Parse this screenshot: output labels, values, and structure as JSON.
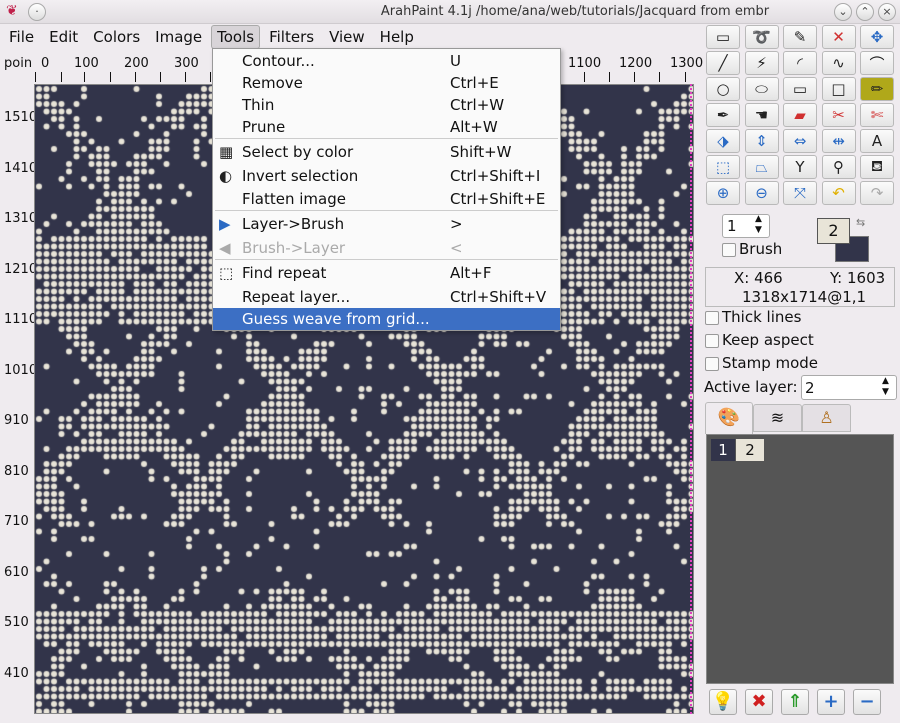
{
  "window": {
    "title": "ArahPaint 4.1j /home/ana/web/tutorials/Jacquard from embr"
  },
  "menubar": [
    "File",
    "Edit",
    "Colors",
    "Image",
    "Tools",
    "Filters",
    "View",
    "Help"
  ],
  "ruler": {
    "unit": "poin",
    "top": [
      "0",
      "100",
      "200",
      "300",
      "1100",
      "1200",
      "1300"
    ],
    "left": [
      "1510",
      "1410",
      "1310",
      "1210",
      "1110",
      "1010",
      "910",
      "810",
      "710",
      "610",
      "510",
      "410"
    ]
  },
  "tools_menu": [
    {
      "label": "Contour...",
      "shortcut": "U"
    },
    {
      "label": "Remove",
      "shortcut": "Ctrl+E"
    },
    {
      "label": "Thin",
      "shortcut": "Ctrl+W"
    },
    {
      "label": "Prune",
      "shortcut": "Alt+W"
    },
    {
      "label": "Select by color",
      "shortcut": "Shift+W",
      "icon": "select-by-color-icon"
    },
    {
      "label": "Invert selection",
      "shortcut": "Ctrl+Shift+I",
      "icon": "invert-selection-icon"
    },
    {
      "label": "Flatten image",
      "shortcut": "Ctrl+Shift+E"
    },
    {
      "label": "Layer->Brush",
      "shortcut": ">",
      "icon": "arrow-right-icon"
    },
    {
      "label": "Brush->Layer",
      "shortcut": "<",
      "icon": "arrow-left-icon",
      "disabled": true
    },
    {
      "label": "Find repeat",
      "shortcut": "Alt+F",
      "icon": "find-repeat-icon"
    },
    {
      "label": "Repeat layer...",
      "shortcut": "Ctrl+Shift+V"
    },
    {
      "label": "Guess weave from grid...",
      "shortcut": "",
      "highlighted": true
    }
  ],
  "panel": {
    "brush_size": "1",
    "brush_label": "Brush",
    "fg_color_index": "2",
    "colors": {
      "fg": "#e8e4d8",
      "bg": "#32344a",
      "accent": "#3c6fc4"
    },
    "x_label": "X: 466",
    "y_label": "Y: 1603",
    "size_label": "1318x1714@1,1",
    "thick_lines": "Thick lines",
    "keep_aspect": "Keep aspect",
    "stamp_mode": "Stamp mode",
    "active_layer_label": "Active layer:",
    "active_layer": "2",
    "layers": [
      "1",
      "2"
    ]
  }
}
